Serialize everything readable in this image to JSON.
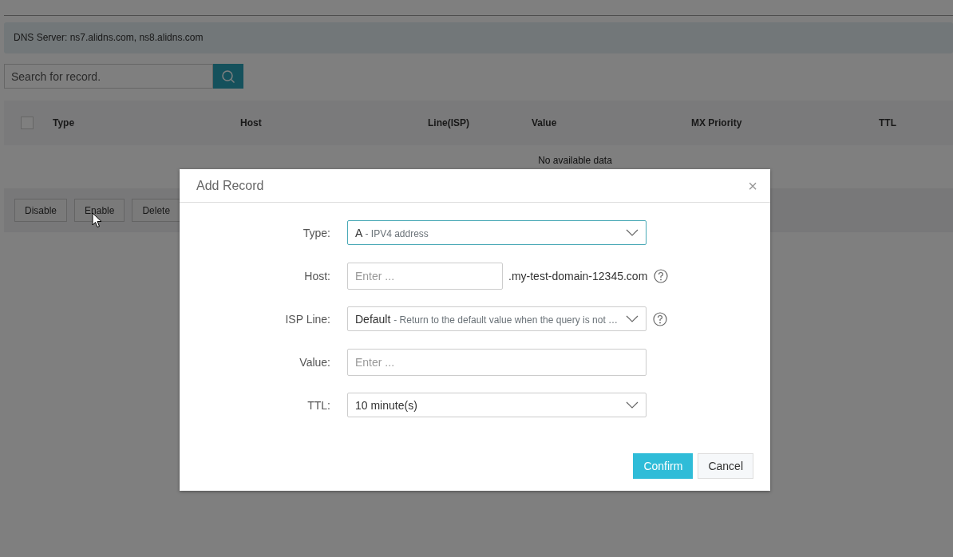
{
  "dns_server": "DNS Server: ns7.alidns.com, ns8.alidns.com",
  "search": {
    "placeholder": "Search for record."
  },
  "table": {
    "select_all": {
      "checked": false
    },
    "columns": [
      "Type",
      "Host",
      "Line(ISP)",
      "Value",
      "MX Priority",
      "TTL"
    ],
    "empty_message": "No available data"
  },
  "actions": [
    "Disable",
    "Enable",
    "Delete"
  ],
  "dialog": {
    "title": "Add Record",
    "close": "×",
    "fields": [
      {
        "kind": "select",
        "label": "Type:",
        "value": "A",
        "hint": "- IPV4 address",
        "focused": true
      },
      {
        "kind": "input",
        "label": "Host:",
        "placeholder": "Enter ...",
        "suffix": ".my-test-domain-12345.com",
        "help": true
      },
      {
        "kind": "select",
        "label": "ISP Line:",
        "value": "Default",
        "hint": "- Return to the default value when the query is not …",
        "help": true,
        "focused": false
      },
      {
        "kind": "input",
        "label": "Value:",
        "placeholder": "Enter ..."
      },
      {
        "kind": "select",
        "label": "TTL:",
        "value": "10 minute(s)",
        "focused": false
      }
    ],
    "buttons": [
      {
        "label": "Confirm",
        "primary": true
      },
      {
        "label": "Cancel",
        "primary": false
      }
    ]
  }
}
